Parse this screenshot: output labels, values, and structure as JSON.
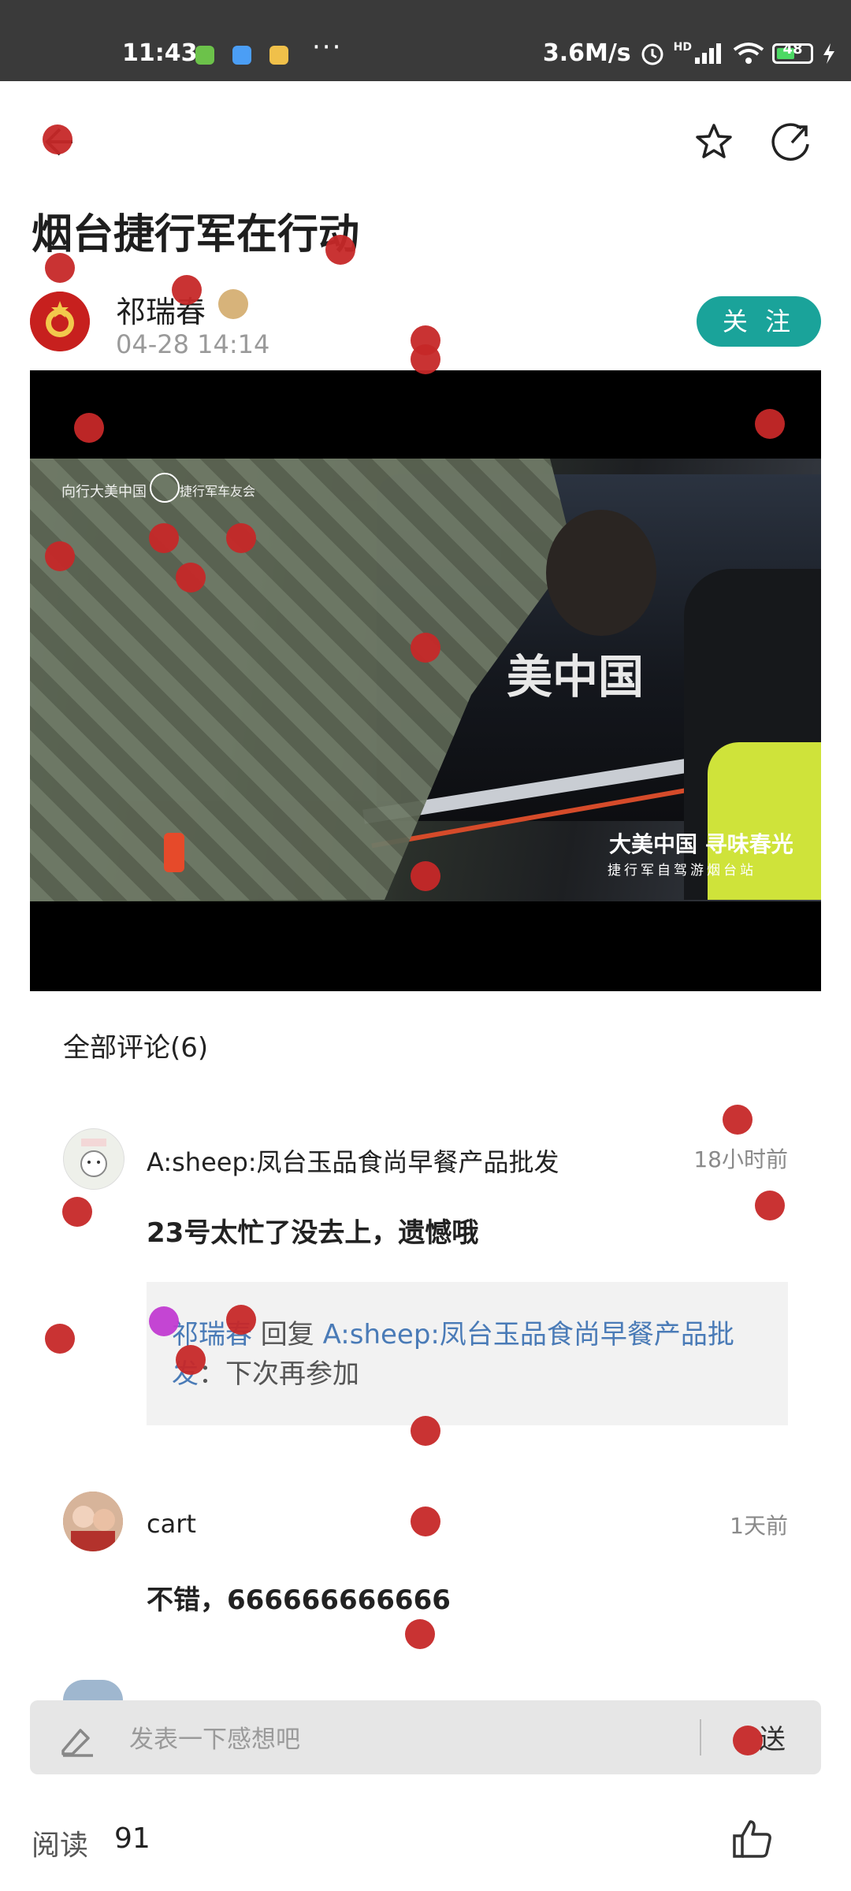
{
  "status_bar": {
    "time": "11:43",
    "more": "···",
    "network_speed": "3.6M/s",
    "hd_label": "HD",
    "battery": "48"
  },
  "toolbar": {
    "back_icon": "back-arrow-icon",
    "favorite_icon": "star-icon",
    "share_icon": "share-icon"
  },
  "post": {
    "title": "烟台捷行军在行动",
    "author_name": "祁瑞春",
    "post_time": "04-28 14:14",
    "follow_label": "关 注"
  },
  "video": {
    "watermark_left": "向行大美中国",
    "watermark_right": "捷行军车友会",
    "car_text": "美中国",
    "slogan": "大美中国 寻味春光",
    "slogan_sub": "捷行军自驾游烟台站"
  },
  "comments": {
    "header": "全部评论(6)",
    "items": [
      {
        "name": "A:sheep:凤台玉品食尚早餐产品批发",
        "time": "18小时前",
        "text": "23号太忙了没去上，遗憾哦",
        "reply": {
          "from": "祁瑞春",
          "verb": " 回复 ",
          "to": "A:sheep:凤台玉品食尚早餐产品批发",
          "text": "：下次再参加"
        }
      },
      {
        "name": "cart",
        "time": "1天前",
        "text": "不错，666666666666"
      }
    ]
  },
  "input_bar": {
    "placeholder": "发表一下感想吧",
    "send_label": "送"
  },
  "footer": {
    "read_label": "阅读",
    "read_count": "91"
  },
  "colors": {
    "accent": "#1aa39a",
    "link": "#4a7bb7",
    "marker": "#c62828",
    "marker_alt": "#c13bd1"
  }
}
